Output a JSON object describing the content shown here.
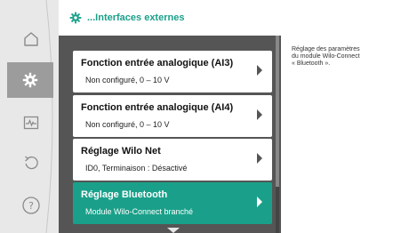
{
  "header": {
    "title": "...Interfaces externes",
    "icon": "gear-icon"
  },
  "nav": {
    "items": [
      {
        "name": "home",
        "icon": "home-icon",
        "active": false
      },
      {
        "name": "settings",
        "icon": "gear-icon",
        "active": true
      },
      {
        "name": "diagnostics",
        "icon": "heartbeat-icon",
        "active": false
      },
      {
        "name": "restore",
        "icon": "undo-icon",
        "active": false
      },
      {
        "name": "help",
        "icon": "question-icon",
        "active": false
      }
    ]
  },
  "menu": {
    "items": [
      {
        "title": "Fonction entrée analogique (AI3)",
        "subtitle": "Non configuré, 0 – 10 V",
        "active": false
      },
      {
        "title": "Fonction entrée analogique (AI4)",
        "subtitle": "Non configuré, 0 – 10 V",
        "active": false
      },
      {
        "title": "Réglage Wilo Net",
        "subtitle": "ID0, Terminaison : Désactivé",
        "active": false
      },
      {
        "title": "Réglage Bluetooth",
        "subtitle": "Module Wilo-Connect branché",
        "active": true
      }
    ]
  },
  "help": {
    "text": "Réglage des paramètres\ndu module Wilo-Connect\n« Bluetooth »."
  },
  "colors": {
    "accent": "#1aa08a",
    "nav_bg": "#e8e8e8",
    "menu_bg": "#555555",
    "nav_active": "#9c9c9c"
  }
}
